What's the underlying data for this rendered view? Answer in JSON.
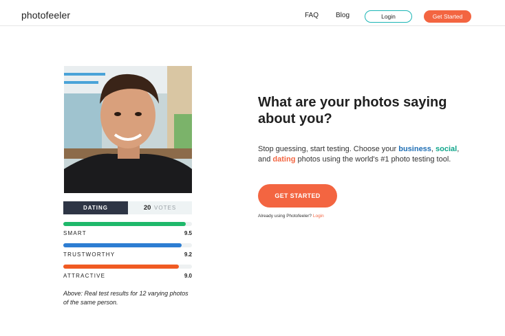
{
  "header": {
    "logo": "photofeeler",
    "nav": {
      "faq": "FAQ",
      "blog": "Blog"
    },
    "login_label": "Login",
    "get_started_label": "Get Started"
  },
  "test_card": {
    "tab_label": "DATING",
    "votes_count": "20",
    "votes_label": "VOTES",
    "metrics": [
      {
        "label": "SMART",
        "value": "9.5",
        "fill": 0.95,
        "color": "#1fb86a"
      },
      {
        "label": "TRUSTWORTHY",
        "value": "9.2",
        "fill": 0.92,
        "color": "#2d7dd2"
      },
      {
        "label": "ATTRACTIVE",
        "value": "9.0",
        "fill": 0.9,
        "color": "#f05a22"
      }
    ],
    "caption": "Above: Real test results for 12 varying photos of the same person."
  },
  "hero": {
    "headline": "What are your photos saying about you?",
    "sub_part1": "Stop guessing, start testing. Choose your ",
    "kw_business": "business",
    "sub_comma": ", ",
    "kw_social": "social",
    "sub_part2": ", and ",
    "kw_dating": "dating",
    "sub_part3": " photos using the world's #1 photo testing tool.",
    "cta_label": "GET STARTED",
    "already_text": "Already using Photofeeler? ",
    "already_login": "Login"
  },
  "colors": {
    "accent": "#f36541",
    "teal": "#19b5b5",
    "dark_tab": "#2e3545"
  }
}
